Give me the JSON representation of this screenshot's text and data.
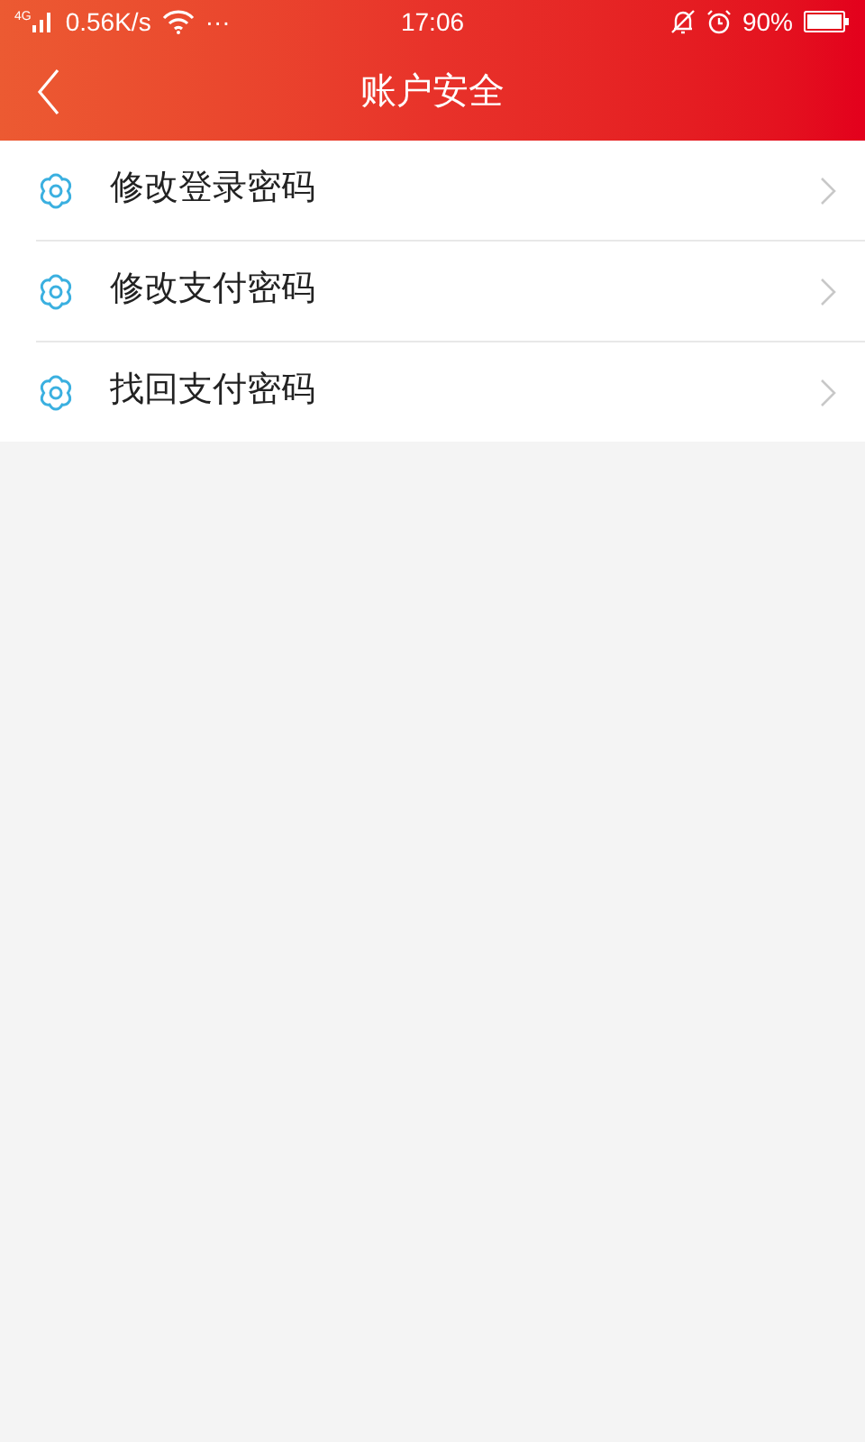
{
  "status_bar": {
    "network": "4G",
    "speed": "0.56K/s",
    "more": "···",
    "time": "17:06",
    "battery": "90%"
  },
  "header": {
    "title": "账户安全"
  },
  "menu": {
    "items": [
      {
        "label": "修改登录密码"
      },
      {
        "label": "修改支付密码"
      },
      {
        "label": "找回支付密码"
      }
    ]
  }
}
